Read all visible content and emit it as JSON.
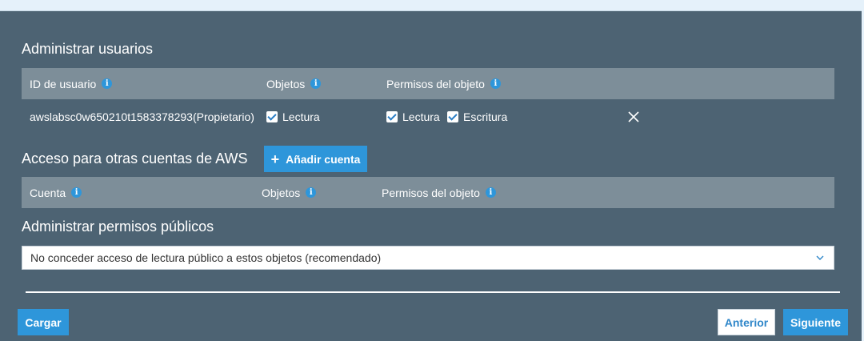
{
  "manage_users": {
    "title": "Administrar usuarios",
    "headers": {
      "user_id": "ID de usuario",
      "objects": "Objetos",
      "object_permissions": "Permisos del objeto"
    },
    "row": {
      "user": "awslabsc0w650210t1583378293(Propietario)",
      "objects_read": "Lectura",
      "perm_read": "Lectura",
      "perm_write": "Escritura"
    }
  },
  "other_accounts": {
    "title": "Acceso para otras cuentas de AWS",
    "add_button": "Añadir cuenta",
    "headers": {
      "account": "Cuenta",
      "objects": "Objetos",
      "object_permissions": "Permisos del objeto"
    }
  },
  "public_permissions": {
    "title": "Administrar permisos públicos",
    "selected": "No conceder acceso de lectura público a estos objetos (recomendado)"
  },
  "footer": {
    "upload": "Cargar",
    "previous": "Anterior",
    "next": "Siguiente"
  },
  "colors": {
    "background": "#4d6373",
    "header_row": "#7d8e99",
    "accent": "#2e96da"
  }
}
